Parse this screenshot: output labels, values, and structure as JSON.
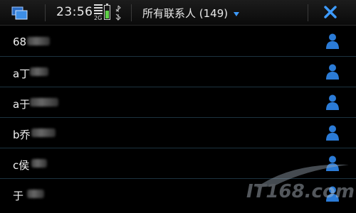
{
  "statusbar": {
    "time": "23:56",
    "signal_label": "2G",
    "title": "所有联系人 (149)",
    "icons": [
      "task-switcher-icon",
      "signal-icon",
      "battery-icon",
      "bluetooth-icon",
      "dropdown-caret-icon",
      "close-icon"
    ]
  },
  "contacts": [
    {
      "label": "68"
    },
    {
      "label": "a丁"
    },
    {
      "label": "a于"
    },
    {
      "label": "b乔"
    },
    {
      "label": "c侯"
    },
    {
      "label": "于"
    }
  ],
  "colors": {
    "accent": "#3d9bff",
    "avatar": "#2b7bd6",
    "battery": "#5fd148",
    "divider": "#1c3340"
  },
  "watermark": {
    "text": "IT168.com"
  }
}
